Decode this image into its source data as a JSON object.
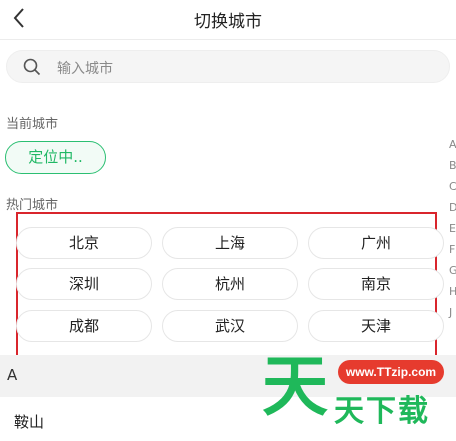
{
  "header": {
    "title": "切换城市"
  },
  "search": {
    "placeholder": "输入城市"
  },
  "current_city": {
    "label": "当前城市",
    "locate_button": "定位中.."
  },
  "hot_cities": {
    "label": "热门城市",
    "rows": [
      [
        "北京",
        "上海",
        "广州"
      ],
      [
        "深圳",
        "杭州",
        "南京"
      ],
      [
        "成都",
        "武汉",
        "天津"
      ]
    ]
  },
  "index_bar": [
    "A",
    "B",
    "C",
    "D",
    "E",
    "F",
    "G",
    "H",
    "J"
  ],
  "city_list": {
    "group_letter": "A",
    "first_city": "鞍山"
  },
  "watermark": {
    "glyph": "天",
    "url": "www.TTzip.com",
    "text": "天下载"
  },
  "colors": {
    "accent_green": "#20b865",
    "highlight_red": "#d9252c",
    "watermark_red": "#e63b2e"
  },
  "icons": {
    "back": "chevron-left-icon",
    "search": "search-icon"
  }
}
